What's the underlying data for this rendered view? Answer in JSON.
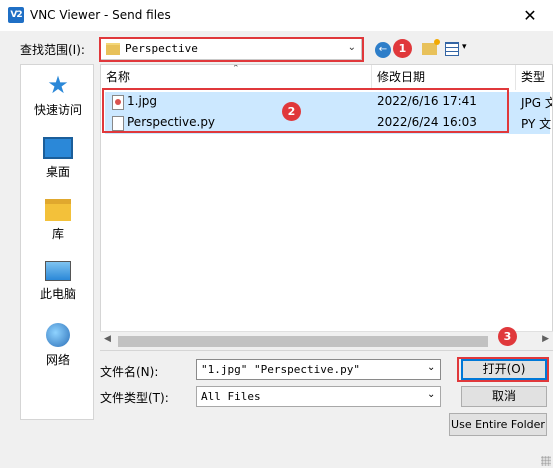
{
  "window": {
    "app_icon_text": "V2",
    "title": "VNC Viewer - Send files",
    "close_glyph": "✕"
  },
  "lookin": {
    "label": "查找范围(I):",
    "value": "Perspective"
  },
  "places": [
    {
      "label": "快速访问",
      "icon": "star-icon"
    },
    {
      "label": "桌面",
      "icon": "desktop-icon"
    },
    {
      "label": "库",
      "icon": "library-icon"
    },
    {
      "label": "此电脑",
      "icon": "computer-icon"
    },
    {
      "label": "网络",
      "icon": "network-icon"
    }
  ],
  "columns": {
    "name": "名称",
    "modified": "修改日期",
    "type": "类型"
  },
  "files": [
    {
      "name": "1.jpg",
      "modified": "2022/6/16 17:41",
      "type": "JPG 文"
    },
    {
      "name": "Perspective.py",
      "modified": "2022/6/24 16:03",
      "type": "PY 文"
    }
  ],
  "filename": {
    "label": "文件名(N):",
    "value": "\"1.jpg\" \"Perspective.py\""
  },
  "filetype": {
    "label": "文件类型(T):",
    "value": "All Files"
  },
  "buttons": {
    "open": "打开(O)",
    "cancel": "取消",
    "entire_folder": "Use Entire Folder"
  },
  "badges": [
    "1",
    "2",
    "3"
  ],
  "colors": {
    "highlight_border": "#e0383b",
    "selection": "#cce8ff",
    "accent": "#0078d7"
  }
}
